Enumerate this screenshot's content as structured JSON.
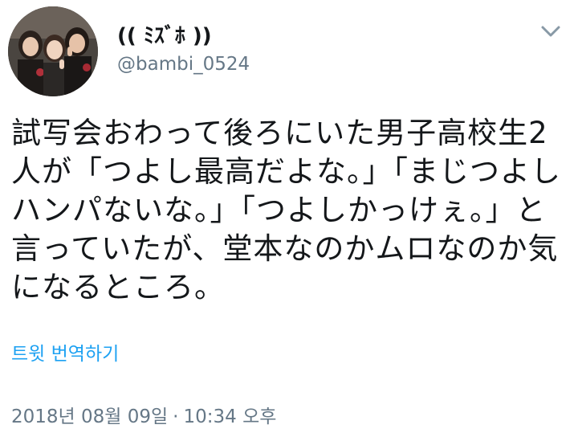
{
  "profile": {
    "display_name": "(( ﾐｽﾞﾎ ))",
    "handle": "@bambi_0524",
    "avatar_icon": "group-photo-avatar"
  },
  "menu": {
    "icon": "chevron-down-icon"
  },
  "tweet": {
    "text": "試写会おわって後ろにいた男子高校生2人が「つよし最高だよな。」「まじつよしハンパないな。」「つよしかっけぇ。」と言っていたが、堂本なのかムロなのか気になるところ。",
    "translate_label": "트윗 번역하기",
    "date": "2018년 08월 09일",
    "separator": "·",
    "time": "10:34 오후"
  },
  "colors": {
    "text": "#14171a",
    "secondary": "#657786",
    "link": "#1da1f2"
  }
}
